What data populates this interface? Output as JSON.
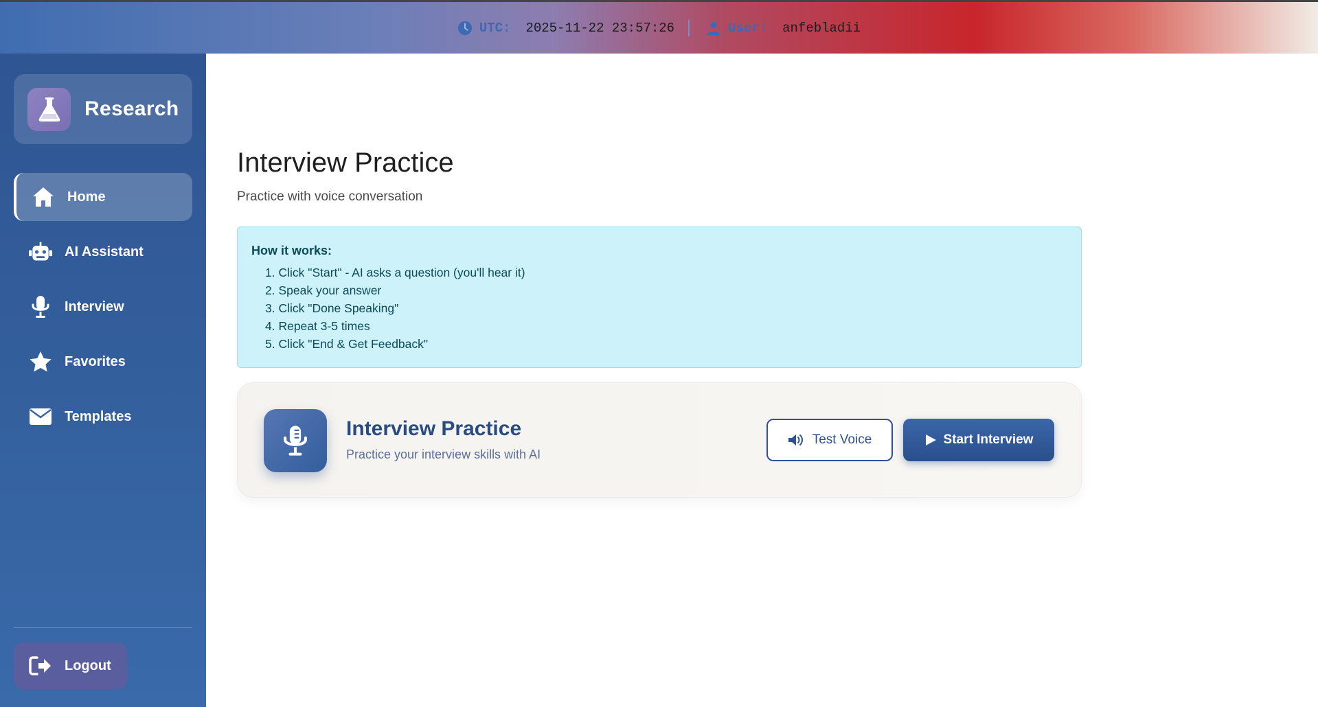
{
  "topbar": {
    "utc_label": "UTC:",
    "utc_value": "2025-11-22 23:57:26",
    "user_label": "User:",
    "user_value": "anfebladii"
  },
  "sidebar": {
    "brand": "Research",
    "items": [
      {
        "label": "Home",
        "icon": "home-icon",
        "active": true
      },
      {
        "label": "AI Assistant",
        "icon": "robot-icon",
        "active": false
      },
      {
        "label": "Interview",
        "icon": "microphone-icon",
        "active": false
      },
      {
        "label": "Favorites",
        "icon": "star-icon",
        "active": false
      },
      {
        "label": "Templates",
        "icon": "envelope-icon",
        "active": false
      }
    ],
    "logout": "Logout"
  },
  "main": {
    "title": "Interview Practice",
    "subtitle": "Practice with voice conversation",
    "info": {
      "title": "How it works:",
      "steps": [
        "1. Click \"Start\" - AI asks a question (you'll hear it)",
        "2. Speak your answer",
        "3. Click \"Done Speaking\"",
        "4. Repeat 3-5 times",
        "5. Click \"End & Get Feedback\""
      ]
    },
    "card": {
      "title": "Interview Practice",
      "subtitle": "Practice your interview skills with AI",
      "test_voice": "Test Voice",
      "start": "Start Interview"
    }
  },
  "colors": {
    "sidebar": "#2f5592",
    "accent": "#2d5394",
    "info_bg": "#cef2fa"
  }
}
